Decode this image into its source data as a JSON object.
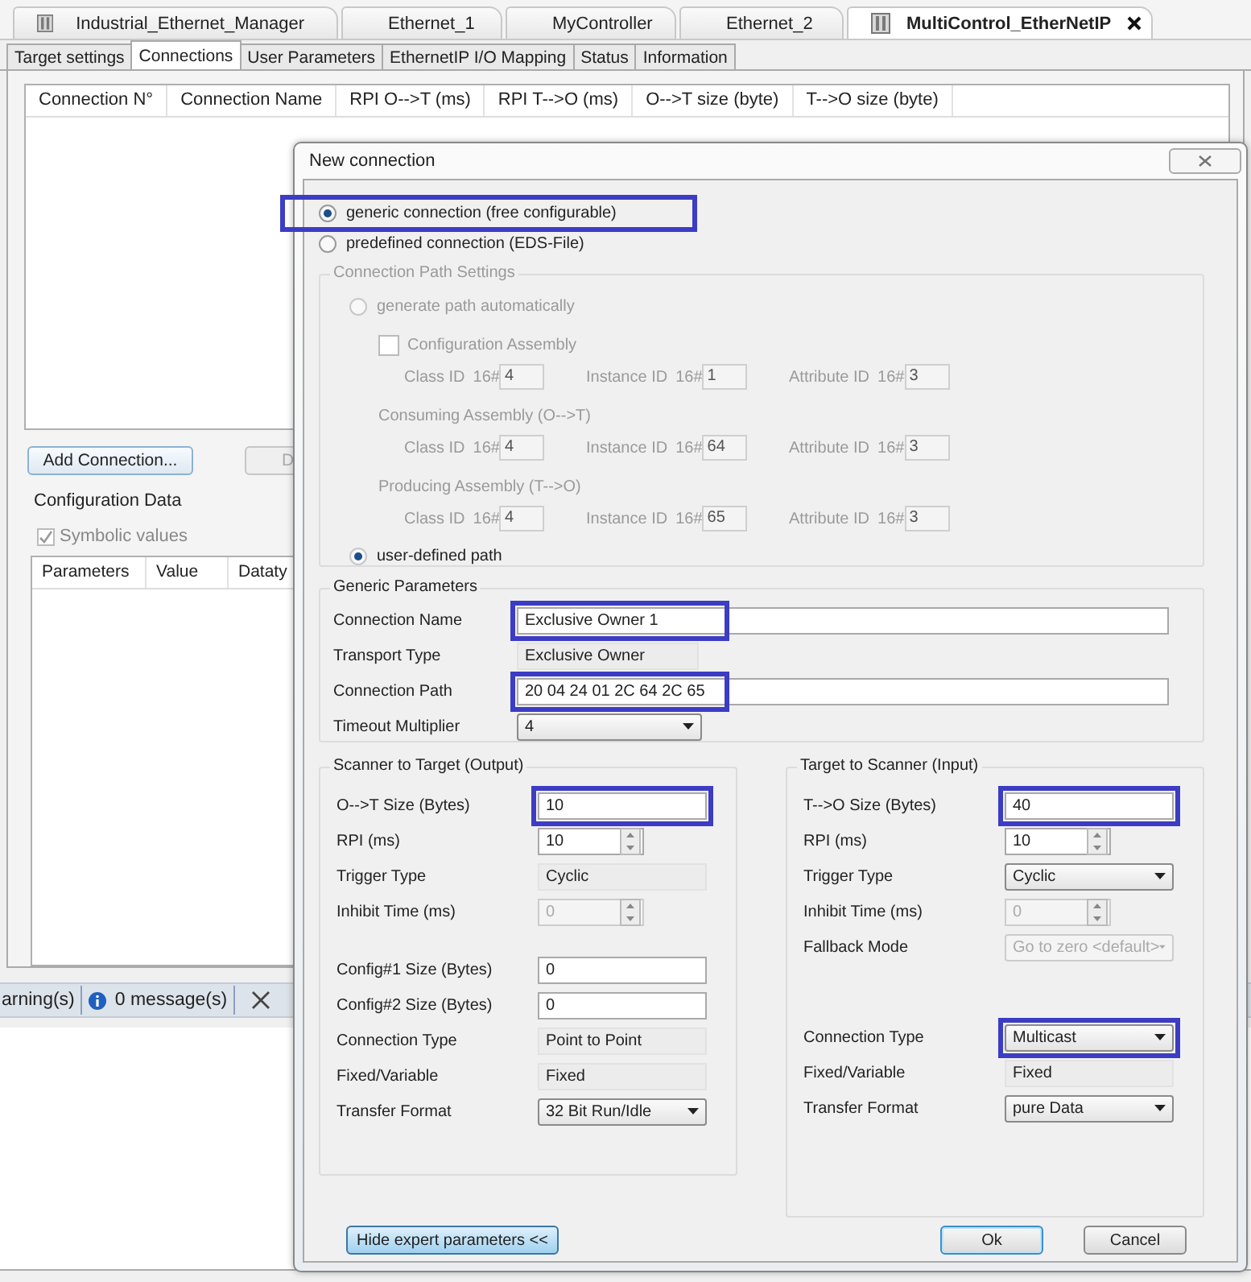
{
  "editor_tabs": [
    {
      "label": "Industrial_Ethernet_Manager",
      "selected": false
    },
    {
      "label": "Ethernet_1",
      "selected": false
    },
    {
      "label": "MyController",
      "selected": false
    },
    {
      "label": "Ethernet_2",
      "selected": false
    },
    {
      "label": "MultiControl_EtherNetIP",
      "selected": true
    }
  ],
  "sub_tabs": [
    {
      "label": "Target settings",
      "selected": false
    },
    {
      "label": "Connections",
      "selected": true
    },
    {
      "label": "User Parameters",
      "selected": false
    },
    {
      "label": "EthernetIP I/O Mapping",
      "selected": false
    },
    {
      "label": "Status",
      "selected": false
    },
    {
      "label": "Information",
      "selected": false
    }
  ],
  "connections_table": {
    "columns": [
      "Connection N°",
      "Connection Name",
      "RPI O-->T (ms)",
      "RPI T-->O (ms)",
      "O-->T size (byte)",
      "T-->O size (byte)"
    ]
  },
  "panel_buttons": [
    "Add Connection...",
    "D"
  ],
  "config_data": {
    "title": "Configuration Data",
    "symbolic_values": {
      "label": "Symbolic values",
      "checked": true,
      "disabled": true
    },
    "columns": [
      "Parameters",
      "Value",
      "Dataty"
    ]
  },
  "messages": {
    "warnings": "arning(s)",
    "messages": "0 message(s)"
  },
  "dialog": {
    "title": "New connection",
    "connection_modes": [
      {
        "label": "generic connection (free configurable)",
        "selected": true,
        "highlighted": true
      },
      {
        "label": "predefined connection (EDS-File)",
        "selected": false
      }
    ],
    "path_settings": {
      "title": "Connection Path Settings",
      "disabled": true,
      "options": [
        {
          "label": "generate path automatically",
          "selected": false
        },
        {
          "label": "user-defined path",
          "selected": true
        }
      ],
      "assemblies": [
        {
          "kind": "checkbox",
          "label": "Configuration Assembly",
          "checked": false,
          "ids": [
            {
              "label": "Class ID",
              "prefix": "16#",
              "value": "4"
            },
            {
              "label": "Instance ID",
              "prefix": "16#",
              "value": "1"
            },
            {
              "label": "Attribute ID",
              "prefix": "16#",
              "value": "3"
            }
          ]
        },
        {
          "kind": "heading",
          "label": "Consuming Assembly (O-->T)",
          "ids": [
            {
              "label": "Class ID",
              "prefix": "16#",
              "value": "4"
            },
            {
              "label": "Instance ID",
              "prefix": "16#",
              "value": "64"
            },
            {
              "label": "Attribute ID",
              "prefix": "16#",
              "value": "3"
            }
          ]
        },
        {
          "kind": "heading",
          "label": "Producing Assembly (T-->O)",
          "ids": [
            {
              "label": "Class ID",
              "prefix": "16#",
              "value": "4"
            },
            {
              "label": "Instance ID",
              "prefix": "16#",
              "value": "65"
            },
            {
              "label": "Attribute ID",
              "prefix": "16#",
              "value": "3"
            }
          ]
        }
      ]
    },
    "generic_parameters": {
      "title": "Generic Parameters",
      "rows": [
        {
          "kind": "input",
          "label": "Connection Name",
          "value": "Exclusive Owner 1",
          "highlighted": true,
          "disabled": false
        },
        {
          "kind": "readonly",
          "label": "Transport Type",
          "value": "Exclusive Owner",
          "disabled": false
        },
        {
          "kind": "input",
          "label": "Connection Path",
          "value": "20 04 24 01 2C 64 2C 65",
          "highlighted": true,
          "disabled": false
        },
        {
          "kind": "select",
          "label": "Timeout Multiplier",
          "value": "4",
          "disabled": false
        }
      ]
    },
    "io_columns": [
      {
        "title": "Scanner to Target (Output)",
        "rows": [
          {
            "kind": "input",
            "label": "O-->T Size (Bytes)",
            "value": "10",
            "highlighted": true,
            "disabled": false
          },
          {
            "kind": "spin",
            "label": "RPI (ms)",
            "value": "10",
            "disabled": false
          },
          {
            "kind": "readonly",
            "label": "Trigger Type",
            "value": "Cyclic",
            "disabled": false
          },
          {
            "kind": "spin",
            "label": "Inhibit Time (ms)",
            "value": "0",
            "disabled": true
          }
        ],
        "extra_rows": [
          {
            "kind": "input",
            "label": "Config#1 Size (Bytes)",
            "value": "0",
            "disabled": false
          },
          {
            "kind": "input",
            "label": "Config#2 Size (Bytes)",
            "value": "0",
            "disabled": false
          },
          {
            "kind": "readonly",
            "label": "Connection Type",
            "value": "Point to Point",
            "disabled": false
          },
          {
            "kind": "readonly",
            "label": "Fixed/Variable",
            "value": "Fixed",
            "disabled": false
          },
          {
            "kind": "select",
            "label": "Transfer Format",
            "value": "32 Bit Run/Idle",
            "disabled": false
          }
        ]
      },
      {
        "title": "Target to Scanner (Input)",
        "rows": [
          {
            "kind": "input",
            "label": "T-->O Size (Bytes)",
            "value": "40",
            "highlighted": true,
            "disabled": false
          },
          {
            "kind": "spin",
            "label": "RPI (ms)",
            "value": "10",
            "disabled": false
          },
          {
            "kind": "select",
            "label": "Trigger Type",
            "value": "Cyclic",
            "disabled": false
          },
          {
            "kind": "spin",
            "label": "Inhibit Time (ms)",
            "value": "0",
            "disabled": true
          },
          {
            "kind": "select",
            "label": "Fallback Mode",
            "value": "Go to zero <default>",
            "disabled": true
          }
        ],
        "extra_rows": [
          {
            "kind": "select",
            "label": "Connection Type",
            "value": "Multicast",
            "highlighted": true,
            "disabled": false
          },
          {
            "kind": "readonly",
            "label": "Fixed/Variable",
            "value": "Fixed",
            "disabled": false
          },
          {
            "kind": "select",
            "label": "Transfer Format",
            "value": "pure Data",
            "disabled": false
          }
        ]
      }
    ],
    "footer_buttons": [
      {
        "kind": "toggle",
        "label": "Hide expert parameters <<"
      },
      {
        "kind": "default",
        "label": "Ok"
      },
      {
        "kind": "normal",
        "label": "Cancel"
      }
    ]
  }
}
